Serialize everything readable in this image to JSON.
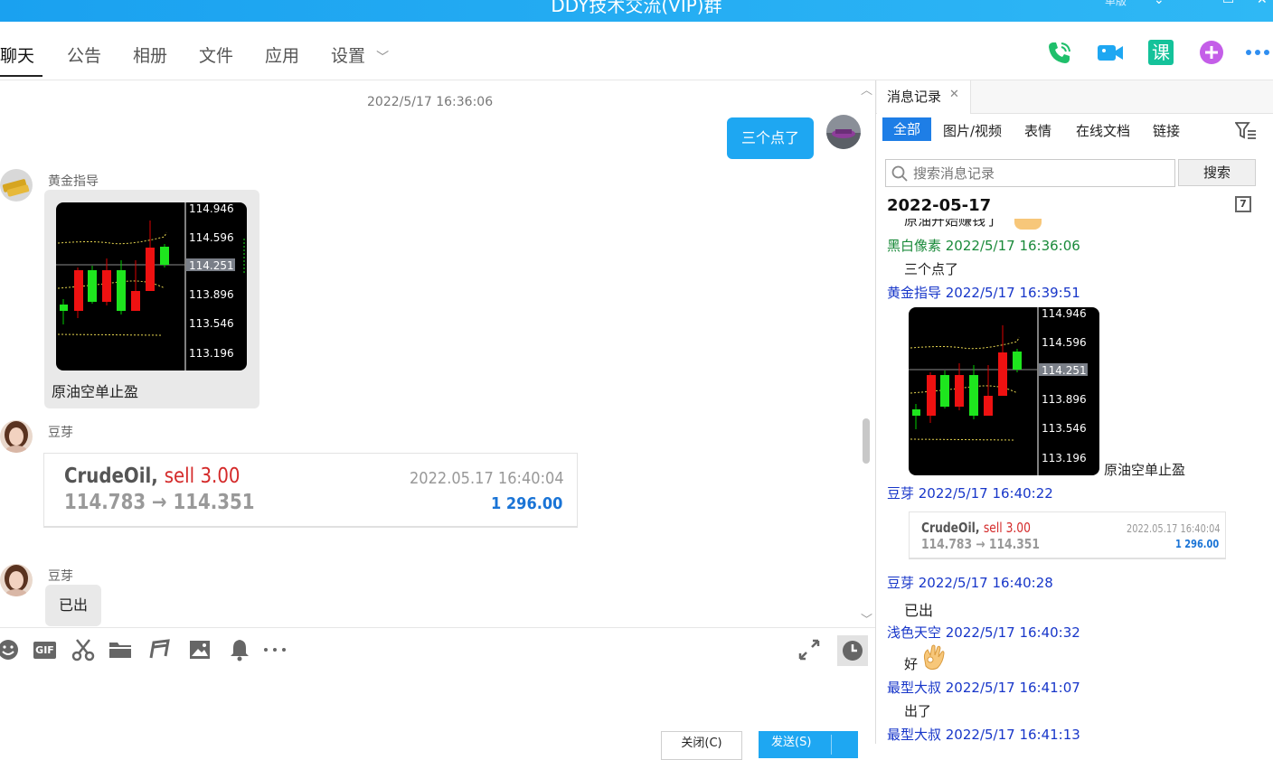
{
  "window": {
    "title": "DDY技术交流(VIP)群",
    "skin_label": "单版"
  },
  "tabs": [
    {
      "label": "聊天"
    },
    {
      "label": "公告"
    },
    {
      "label": "相册"
    },
    {
      "label": "文件"
    },
    {
      "label": "应用"
    },
    {
      "label": "设置"
    }
  ],
  "header_icons": [
    "phone-icon",
    "video-icon",
    "course-icon",
    "add-app-icon",
    "more-icon"
  ],
  "header_icon_text": {
    "course": "课"
  },
  "chat": {
    "timestamp": "2022/5/17 16:36:06",
    "my_message": "三个点了",
    "msg1_sender": "黄金指导",
    "msg1_caption": "原油空单止盈",
    "msg2_sender": "豆芽",
    "msg3_sender": "豆芽",
    "msg3_text": "已出"
  },
  "chart_prices": {
    "levels": [
      "114.946",
      "114.596",
      "114.251",
      "113.896",
      "113.546",
      "113.196"
    ],
    "highlight": "114.251"
  },
  "trade_card": {
    "symbol": "CrudeOil,",
    "action": "sell 3.00",
    "prices": "114.783 → 114.351",
    "datetime": "2022.05.17 16:40:04",
    "profit": "1 296.00"
  },
  "toolbar": {
    "icons": [
      "emoji-icon",
      "gif-icon",
      "scissors-icon",
      "folder-icon",
      "music-icon",
      "image-icon",
      "bell-icon",
      "more-dots-icon"
    ],
    "gif_text": "GIF",
    "close_label": "关闭(C)",
    "send_label": "发送(S)"
  },
  "history": {
    "tab_title": "消息记录",
    "filters": [
      "全部",
      "图片/视频",
      "表情",
      "在线文档",
      "链接"
    ],
    "search_placeholder": "搜索消息记录",
    "search_button": "搜索",
    "date": "2022-05-17",
    "calendar_day": "7",
    "partial_text": "原油开始赚钱了",
    "entries": [
      {
        "meta": "黑白像素 2022/5/17 16:36:06",
        "text": "三个点了"
      },
      {
        "meta": "黄金指导 2022/5/17 16:39:51",
        "text": "原油空单止盈"
      },
      {
        "meta": "豆芽 2022/5/17 16:40:22"
      },
      {
        "meta": "豆芽 2022/5/17 16:40:28",
        "text": "已出"
      },
      {
        "meta": "浅色天空 2022/5/17 16:40:32",
        "text": "好"
      },
      {
        "meta": "最型大叔 2022/5/17 16:41:07",
        "text": "出了"
      },
      {
        "meta": "最型大叔 2022/5/17 16:41:13"
      }
    ]
  },
  "colors": {
    "accent": "#1ea7f2",
    "history_blue": "#1736c9",
    "history_green": "#1a8a3a",
    "sell_red": "#d42a2a",
    "profit_blue": "#1a74d6"
  }
}
